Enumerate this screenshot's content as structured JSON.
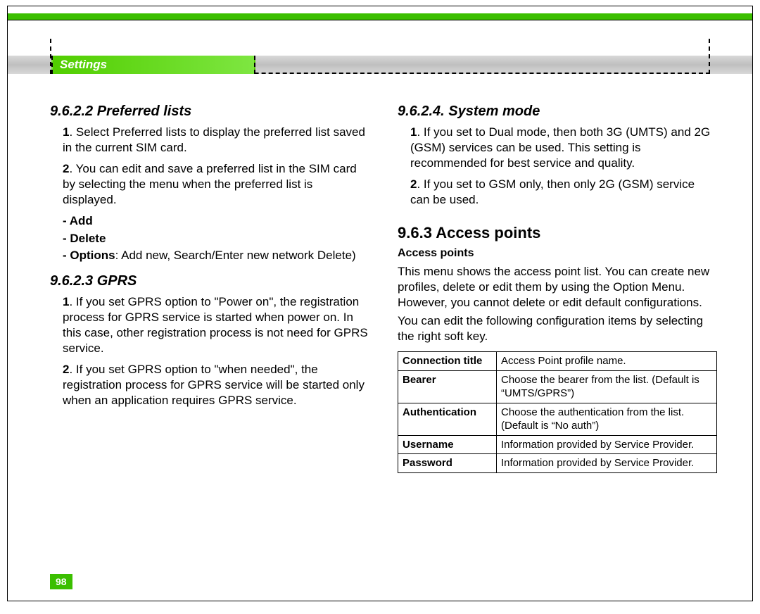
{
  "header": {
    "tab": "Settings"
  },
  "page_number": "98",
  "left": {
    "s1": {
      "title": "9.6.2.2 Preferred lists",
      "p1_num": "1",
      "p1": ". Select Preferred lists to display the preferred list saved in the current SIM card.",
      "p2_num": "2",
      "p2": ". You can edit and save a preferred list in the SIM card by selecting the menu when the preferred list is displayed.",
      "b1": "- Add",
      "b2": "- Delete",
      "b3_label": "- Options",
      "b3_rest": ": Add new, Search/Enter new network Delete)"
    },
    "s2": {
      "title": "9.6.2.3 GPRS",
      "p1_num": "1",
      "p1": ". If you set GPRS option to \"Power on\", the registration process for GPRS service is started when power on. In this case, other registration process is not need for GPRS service.",
      "p2_num": "2",
      "p2": ". If you set GPRS option to \"when needed\", the registration process for GPRS service will be started only when an application requires GPRS service."
    }
  },
  "right": {
    "s1": {
      "title": "9.6.2.4. System mode",
      "p1_num": "1",
      "p1": ". If you set to Dual mode, then both 3G (UMTS) and 2G (GSM) services can be used. This setting is recommended for best service and quality.",
      "p2_num": "2",
      "p2": ". If you set to GSM only, then only 2G (GSM) service can be used."
    },
    "s2": {
      "title": "9.6.3 Access points",
      "sub": "Access points",
      "p1": "This menu shows the access point list. You can create new profiles, delete or edit them by using the Option Menu. However, you cannot delete or edit default configurations.",
      "p2": "You can edit the following configuration items by selecting the right soft key.",
      "table": [
        {
          "k": "Connection title",
          "v": "Access Point profile name."
        },
        {
          "k": "Bearer",
          "v": "Choose the bearer from the list. (Default is “UMTS/GPRS”)"
        },
        {
          "k": "Authentication",
          "v": "Choose the authentication from the list. (Default is “No auth”)"
        },
        {
          "k": "Username",
          "v": "Information provided by Service Provider."
        },
        {
          "k": "Password",
          "v": "Information provided by Service Provider."
        }
      ]
    }
  }
}
